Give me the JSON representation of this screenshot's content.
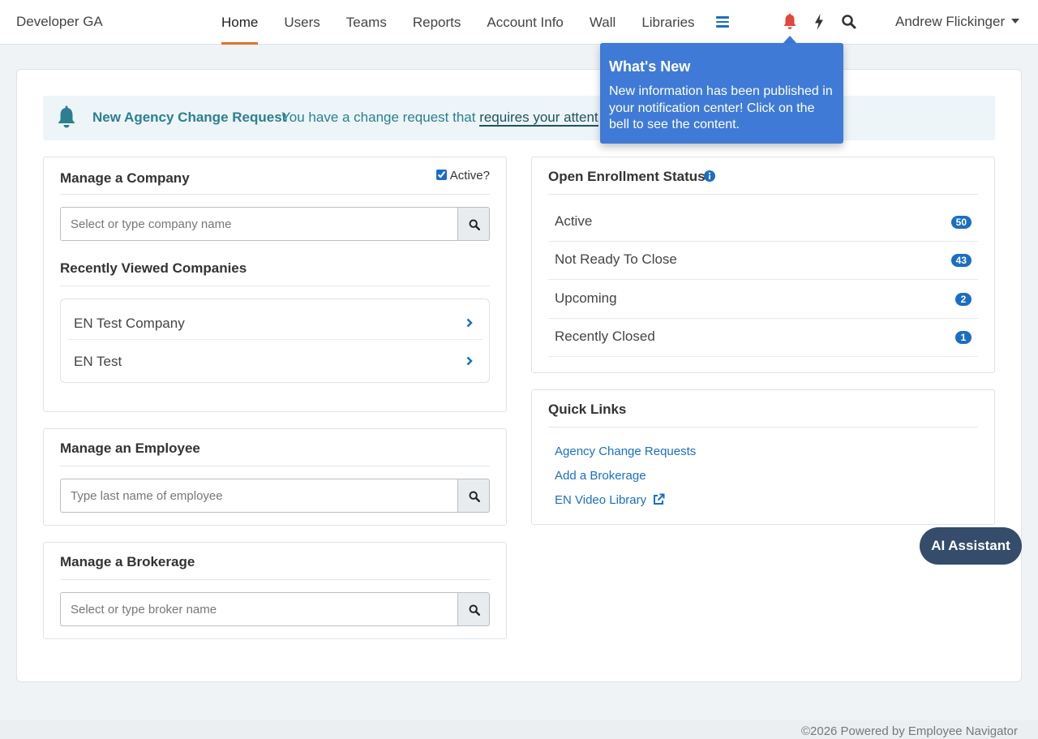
{
  "nav": {
    "brand": "Developer GA",
    "links": [
      "Home",
      "Users",
      "Teams",
      "Reports",
      "Account Info",
      "Wall",
      "Libraries"
    ],
    "active_link": "Home",
    "user_name": "Andrew Flickinger",
    "icons": [
      "menu-icon",
      "bell-icon",
      "bolt-icon",
      "search-icon"
    ],
    "bell_color": "#e1473d",
    "active_underline_color": "#e1702e"
  },
  "tooltip": {
    "title": "What's New",
    "body": "New information has been published in your notification center! Click on the bell to see the content."
  },
  "alert": {
    "title": "New Agency Change Request",
    "message": "You have a change request that",
    "link": "requires your attent"
  },
  "manage_company": {
    "title": "Manage a Company",
    "active_label": "Active?",
    "active_checked": true,
    "search_placeholder": "Select or type company name",
    "recent_title": "Recently Viewed Companies",
    "recent": [
      "EN Test Company",
      "EN Test"
    ]
  },
  "manage_employee": {
    "title": "Manage an Employee",
    "search_placeholder": "Type last name of employee"
  },
  "manage_brokerage": {
    "title": "Manage a Brokerage",
    "search_placeholder": "Select or type broker name"
  },
  "enrollment": {
    "title": "Open Enrollment Status",
    "rows": [
      {
        "label": "Active",
        "count": "50"
      },
      {
        "label": "Not Ready To Close",
        "count": "43"
      },
      {
        "label": "Upcoming",
        "count": "2"
      },
      {
        "label": "Recently Closed",
        "count": "1"
      }
    ]
  },
  "quick_links": {
    "title": "Quick Links",
    "links": [
      "Agency Change Requests",
      "Add a Brokerage",
      "EN Video Library"
    ]
  },
  "ai_button": "AI Assistant",
  "footer": "©2026 Powered by Employee Navigator"
}
